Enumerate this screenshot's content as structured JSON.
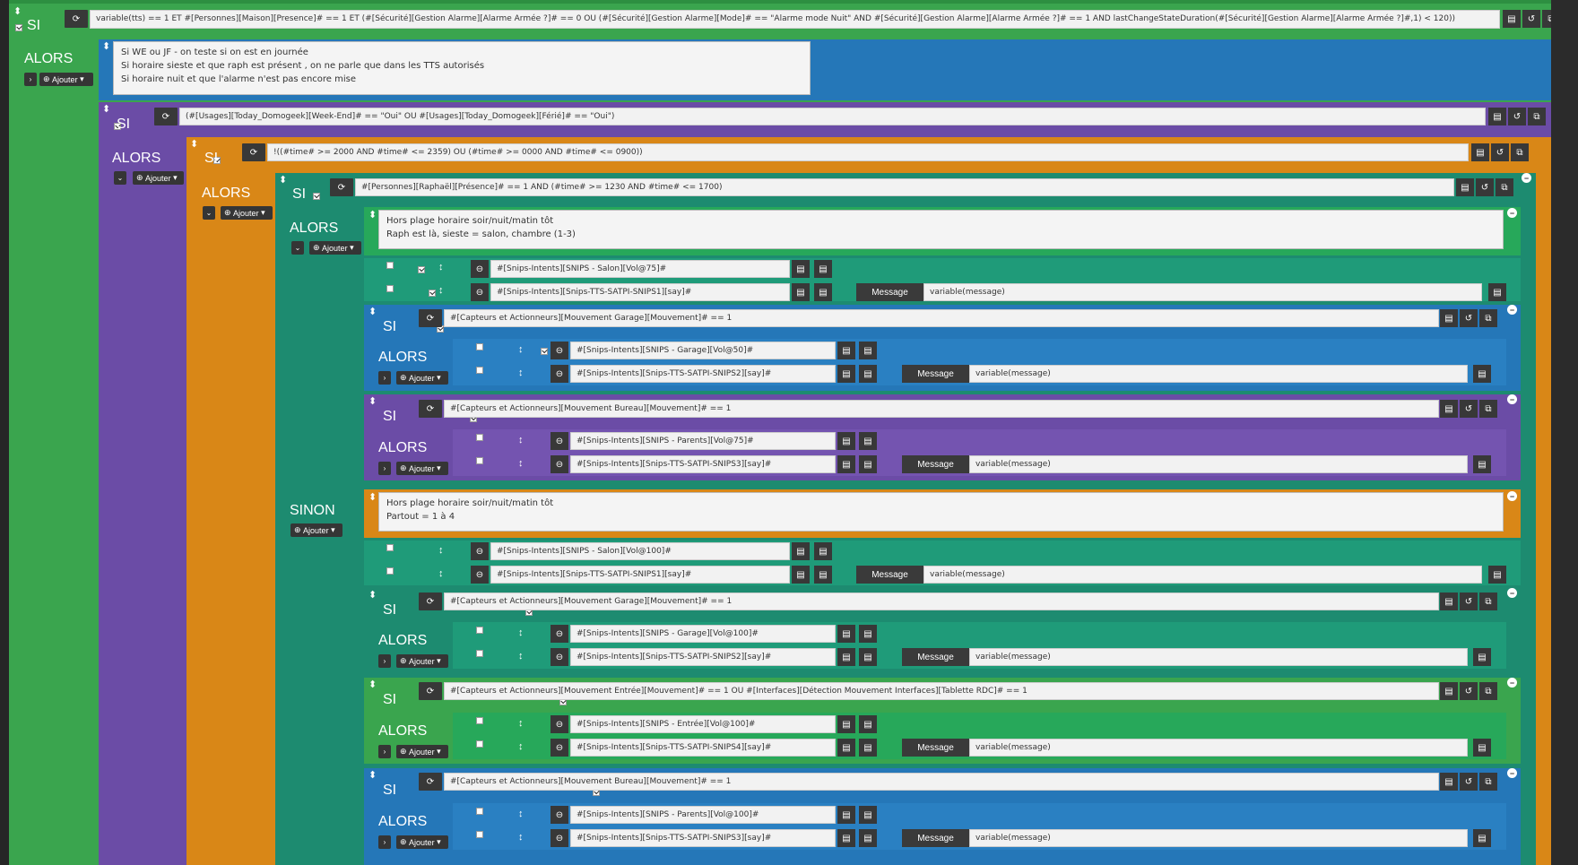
{
  "labels": {
    "si": "SI",
    "alors": "ALORS",
    "sinon": "SINON",
    "ajouter": "Ajouter",
    "message": "Message"
  },
  "colors": {
    "green": "#3aa54e",
    "teal": "#1d8b70",
    "blue": "#2577b8",
    "purple": "#6b4ca6",
    "orange": "#d98717",
    "background": "#262626"
  },
  "icons": {
    "refresh": "refresh-icon",
    "expression": "expression-icon",
    "history": "history-icon",
    "copy": "copy-icon",
    "remove": "minus-circle-icon",
    "move": "move-icon",
    "collapse": "chevron-icon",
    "add": "plus-circle-icon"
  },
  "blocks": {
    "root_condition": "variable(tts) == 1 ET #[Personnes][Maison][Presence]# == 1 ET (#[Sécurité][Gestion Alarme][Alarme Armée ?]# == 0 OU (#[Sécurité][Gestion Alarme][Mode]# == \"Alarme mode Nuit\" AND #[Sécurité][Gestion Alarme][Alarme Armée ?]# == 1 AND lastChangeStateDuration(#[Sécurité][Gestion Alarme][Alarme Armée ?]#,1) < 120))",
    "comment1": "Si WE ou JF - on teste si on est en journée\nSi horaire sieste et que raph est présent , on ne parle que dans les TTS autorisés\nSi horaire nuit et que l'alarme n'est pas encore mise",
    "cond_weekend": "(#[Usages][Today_Domogeek][Week-End]# == \"Oui\" OU #[Usages][Today_Domogeek][Férié]# == \"Oui\")",
    "cond_time": "!((#time# >= 2000 AND #time# <= 2359) OU (#time# >= 0000 AND #time# <= 0900))",
    "cond_raph": "#[Personnes][Raphaël][Présence]# == 1 AND (#time# >= 1230 AND #time# <= 1700)",
    "comment2": "Hors plage horaire soir/nuit/matin tôt\nRaph est là, sieste = salon, chambre (1-3)",
    "comment3": "Hors plage horaire soir/nuit/matin tôt\nPartout = 1 à 4",
    "message_value": "variable(message)",
    "a_salon_vol75": "#[Snips-Intents][SNIPS - Salon][Vol@75]#",
    "a_say1": "#[Snips-Intents][Snips-TTS-SATPI-SNIPS1][say]#",
    "cond_garage": "#[Capteurs et Actionneurs][Mouvement Garage][Mouvement]# == 1",
    "a_garage_vol50": "#[Snips-Intents][SNIPS - Garage][Vol@50]#",
    "a_say2": "#[Snips-Intents][Snips-TTS-SATPI-SNIPS2][say]#",
    "cond_bureau": "#[Capteurs et Actionneurs][Mouvement Bureau][Mouvement]# == 1",
    "a_parents_vol75": "#[Snips-Intents][SNIPS - Parents][Vol@75]#",
    "a_say3": "#[Snips-Intents][Snips-TTS-SATPI-SNIPS3][say]#",
    "a_salon_vol100": "#[Snips-Intents][SNIPS - Salon][Vol@100]#",
    "a_garage_vol100": "#[Snips-Intents][SNIPS - Garage][Vol@100]#",
    "cond_entree": "#[Capteurs et Actionneurs][Mouvement Entrée][Mouvement]# == 1 OU #[Interfaces][Détection Mouvement Interfaces][Tablette RDC]# == 1",
    "a_entree_vol100": "#[Snips-Intents][SNIPS - Entrée][Vol@100]#",
    "a_say4": "#[Snips-Intents][Snips-TTS-SATPI-SNIPS4][say]#",
    "a_parents_vol100": "#[Snips-Intents][SNIPS - Parents][Vol@100]#"
  }
}
